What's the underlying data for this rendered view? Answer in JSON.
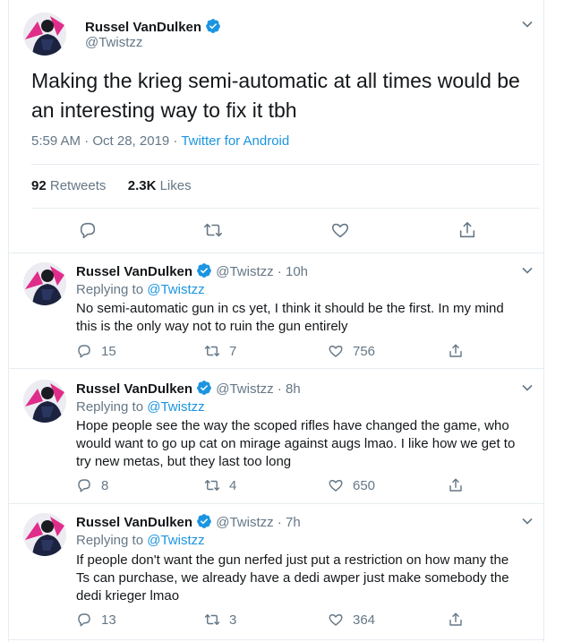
{
  "main_tweet": {
    "display_name": "Russel VanDulken",
    "handle": "@Twistzz",
    "text": "Making the krieg semi-automatic at all times would be an interesting way to fix it tbh",
    "timestamp": "5:59 AM · Oct 28, 2019 · ",
    "source": "Twitter for Android",
    "retweets_count": "92",
    "retweets_label": "Retweets",
    "likes_count": "2.3K",
    "likes_label": "Likes"
  },
  "replies": [
    {
      "display_name": "Russel VanDulken",
      "handle": "@Twistzz",
      "time": "10h",
      "replying_label": "Replying to",
      "replying_to": "@Twistzz",
      "text": "No semi-automatic gun in cs yet, I think it should be the first. In my mind this is the only way not to ruin the gun entirely",
      "replies": "15",
      "retweets": "7",
      "likes": "756"
    },
    {
      "display_name": "Russel VanDulken",
      "handle": "@Twistzz",
      "time": "8h",
      "replying_label": "Replying to",
      "replying_to": "@Twistzz",
      "text": "Hope people see the way the scoped rifles have changed the game, who would want to go up cat on mirage against augs lmao. I like how we get to try new metas, but they last too long",
      "replies": "8",
      "retweets": "4",
      "likes": "650"
    },
    {
      "display_name": "Russel VanDulken",
      "handle": "@Twistzz",
      "time": "7h",
      "replying_label": "Replying to",
      "replying_to": "@Twistzz",
      "text": "If people don't want the gun nerfed just put a restriction on how many the Ts can purchase, we already have a dedi awper just make somebody the dedi krieger lmao",
      "replies": "13",
      "retweets": "3",
      "likes": "364"
    }
  ],
  "icons": {
    "verified": "verified-badge-icon",
    "more": "chevron-down-icon",
    "reply": "reply-icon",
    "retweet": "retweet-icon",
    "like": "heart-icon",
    "share": "share-icon"
  },
  "colors": {
    "accent": "#1b95e0",
    "text": "#14171a",
    "secondary": "#657786",
    "divider": "#e6ecf0"
  }
}
